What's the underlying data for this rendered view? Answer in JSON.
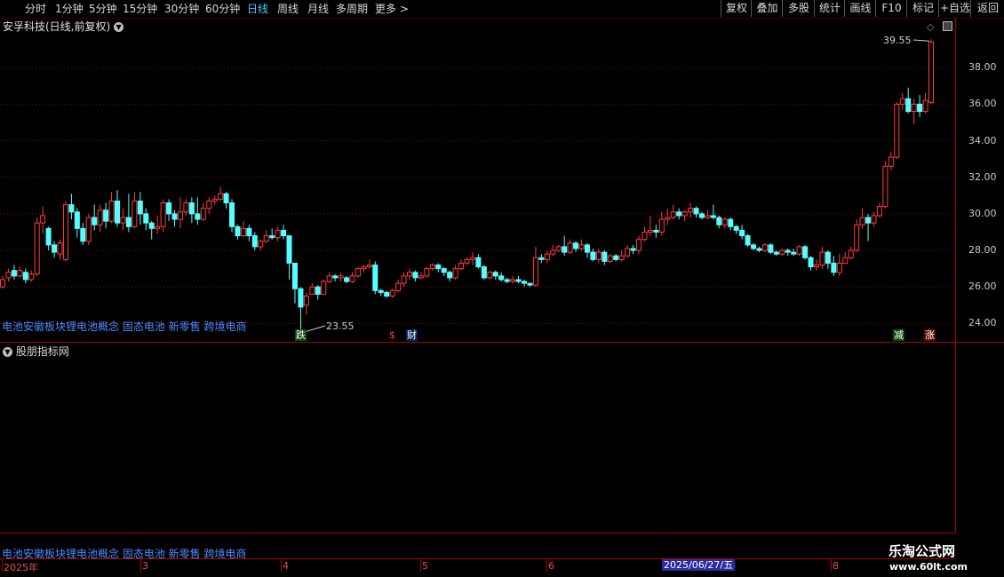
{
  "toolbar": {
    "periods": [
      "分时",
      "1分钟",
      "5分钟",
      "15分钟",
      "30分钟",
      "60分钟",
      "日线",
      "周线",
      "月线",
      "多周期",
      "更多 >"
    ],
    "active_period": "日线",
    "right_buttons": [
      "复权",
      "叠加",
      "多股",
      "统计",
      "画线",
      "F10",
      "标记",
      "+自选",
      "返回"
    ]
  },
  "chart_title": "安孚科技(日线,前复权)",
  "concepts": "电池安徽板块锂电池概念 固态电池 新零售 跨境电商",
  "indicator_title": "股朋指标网",
  "price_labels": [
    "38.00",
    "36.00",
    "34.00",
    "32.00",
    "30.00",
    "28.00",
    "26.00",
    "24.00"
  ],
  "high_marker": "39.55",
  "low_marker": "23.55",
  "tags": {
    "die": "跌",
    "s": "$",
    "cai": "财",
    "jian": "减",
    "zhang": "涨"
  },
  "dates": [
    "2025年",
    "3",
    "4",
    "5",
    "6",
    "8"
  ],
  "date_highlight": "2025/06/27/五",
  "watermark": {
    "title": "乐淘公式网",
    "url": "www.60lt.com"
  },
  "colors": {
    "up": "#ff3b3b",
    "down": "#54ffff",
    "grid": "#8a0000",
    "concept": "#4a8cff"
  },
  "chart_data": {
    "type": "candlestick",
    "ylim": [
      23,
      40
    ],
    "candles": [
      [
        26.0,
        26.4,
        25.9,
        26.6
      ],
      [
        26.5,
        26.8,
        26.3,
        27.0
      ],
      [
        26.9,
        26.6,
        26.4,
        27.2
      ],
      [
        26.6,
        26.9,
        26.5,
        27.1
      ],
      [
        26.8,
        26.4,
        26.2,
        27.0
      ],
      [
        26.4,
        26.7,
        26.3,
        26.9
      ],
      [
        26.7,
        29.5,
        26.6,
        29.8
      ],
      [
        29.5,
        29.9,
        28.9,
        30.4
      ],
      [
        29.2,
        28.3,
        28.0,
        29.3
      ],
      [
        28.3,
        27.9,
        27.6,
        28.5
      ],
      [
        27.8,
        28.4,
        27.5,
        28.6
      ],
      [
        27.5,
        30.5,
        27.4,
        30.7
      ],
      [
        30.5,
        30.1,
        29.7,
        31.1
      ],
      [
        30.1,
        29.2,
        28.7,
        30.3
      ],
      [
        29.2,
        28.5,
        28.3,
        29.5
      ],
      [
        28.5,
        29.8,
        28.3,
        30.0
      ],
      [
        29.8,
        29.4,
        29.1,
        30.5
      ],
      [
        29.4,
        30.2,
        29.0,
        30.5
      ],
      [
        30.2,
        29.6,
        29.2,
        30.6
      ],
      [
        29.6,
        30.7,
        29.5,
        31.2
      ],
      [
        30.7,
        29.5,
        29.3,
        31.3
      ],
      [
        29.5,
        29.8,
        29.1,
        30.3
      ],
      [
        29.8,
        29.3,
        29.0,
        31.1
      ],
      [
        29.3,
        30.7,
        29.2,
        31.2
      ],
      [
        30.7,
        30.0,
        29.4,
        31.2
      ],
      [
        30.0,
        29.5,
        29.1,
        30.3
      ],
      [
        29.5,
        29.2,
        28.6,
        29.6
      ],
      [
        29.2,
        29.3,
        28.9,
        29.9
      ],
      [
        29.3,
        30.6,
        29.0,
        30.8
      ],
      [
        30.6,
        30.0,
        29.6,
        30.8
      ],
      [
        30.0,
        29.7,
        29.3,
        30.2
      ],
      [
        29.7,
        30.1,
        29.2,
        30.9
      ],
      [
        30.1,
        30.6,
        29.9,
        30.8
      ],
      [
        30.6,
        30.0,
        29.5,
        30.9
      ],
      [
        30.0,
        29.7,
        29.4,
        30.9
      ],
      [
        29.7,
        30.3,
        29.6,
        30.6
      ],
      [
        30.3,
        30.7,
        30.0,
        30.9
      ],
      [
        30.7,
        30.8,
        30.5,
        31.0
      ],
      [
        30.8,
        31.1,
        30.7,
        31.5
      ],
      [
        31.1,
        30.6,
        30.3,
        31.2
      ],
      [
        30.6,
        29.3,
        29.0,
        30.8
      ],
      [
        29.3,
        28.8,
        28.6,
        29.4
      ],
      [
        28.8,
        29.2,
        28.7,
        29.6
      ],
      [
        29.2,
        28.8,
        28.5,
        29.4
      ],
      [
        28.8,
        28.2,
        28.0,
        29.0
      ],
      [
        28.2,
        28.5,
        28.0,
        28.6
      ],
      [
        28.5,
        28.8,
        28.4,
        29.1
      ],
      [
        28.8,
        28.7,
        28.6,
        29.2
      ],
      [
        28.7,
        29.1,
        28.5,
        29.3
      ],
      [
        29.1,
        28.8,
        28.6,
        29.4
      ],
      [
        28.8,
        27.3,
        26.4,
        28.3
      ],
      [
        27.3,
        25.9,
        25.1,
        27.3
      ],
      [
        25.9,
        24.9,
        23.5,
        26.0
      ],
      [
        25.0,
        25.5,
        24.5,
        25.7
      ],
      [
        25.6,
        26.0,
        25.6,
        26.2
      ],
      [
        26.0,
        25.6,
        25.3,
        26.1
      ],
      [
        25.6,
        26.3,
        25.6,
        26.4
      ],
      [
        26.3,
        26.6,
        26.2,
        26.8
      ],
      [
        26.6,
        26.5,
        26.3,
        26.7
      ],
      [
        26.5,
        26.6,
        26.3,
        26.8
      ],
      [
        26.5,
        26.3,
        26.2,
        26.6
      ],
      [
        26.3,
        26.6,
        26.2,
        26.8
      ],
      [
        26.6,
        27.0,
        26.5,
        27.1
      ],
      [
        27.0,
        27.1,
        26.8,
        27.2
      ],
      [
        27.1,
        27.2,
        27.0,
        27.5
      ],
      [
        27.2,
        25.8,
        25.6,
        27.4
      ],
      [
        25.8,
        25.7,
        25.5,
        25.9
      ],
      [
        25.7,
        25.5,
        25.4,
        25.8
      ],
      [
        25.5,
        25.8,
        25.4,
        25.9
      ],
      [
        25.8,
        26.2,
        25.7,
        26.4
      ],
      [
        26.2,
        26.6,
        26.0,
        26.8
      ],
      [
        26.6,
        26.8,
        26.4,
        27.0
      ],
      [
        26.8,
        26.5,
        26.3,
        26.9
      ],
      [
        26.5,
        26.6,
        26.4,
        26.8
      ],
      [
        26.6,
        27.0,
        26.5,
        27.1
      ],
      [
        27.0,
        27.2,
        26.9,
        27.3
      ],
      [
        27.2,
        27.0,
        26.8,
        27.3
      ],
      [
        27.0,
        26.8,
        26.6,
        27.1
      ],
      [
        26.8,
        26.5,
        26.3,
        26.9
      ],
      [
        26.5,
        27.0,
        26.4,
        27.2
      ],
      [
        27.0,
        27.3,
        26.9,
        27.5
      ],
      [
        27.3,
        27.5,
        27.2,
        27.6
      ],
      [
        27.5,
        27.6,
        27.2,
        27.9
      ],
      [
        27.6,
        27.1,
        27.0,
        27.8
      ],
      [
        27.1,
        26.5,
        26.4,
        27.2
      ],
      [
        26.5,
        26.8,
        26.4,
        26.9
      ],
      [
        26.8,
        26.6,
        26.4,
        26.9
      ],
      [
        26.6,
        26.4,
        26.3,
        26.8
      ],
      [
        26.4,
        26.3,
        26.2,
        26.5
      ],
      [
        26.3,
        26.4,
        26.2,
        26.6
      ],
      [
        26.4,
        26.3,
        26.2,
        26.6
      ],
      [
        26.3,
        26.2,
        26.0,
        26.4
      ],
      [
        26.2,
        26.1,
        26.0,
        26.2
      ],
      [
        26.1,
        27.6,
        26.0,
        28.2
      ],
      [
        27.6,
        27.5,
        27.3,
        27.8
      ],
      [
        27.5,
        27.8,
        27.3,
        28.0
      ],
      [
        27.8,
        28.0,
        27.7,
        28.3
      ],
      [
        28.0,
        28.2,
        27.9,
        28.3
      ],
      [
        28.2,
        27.9,
        27.7,
        28.8
      ],
      [
        27.9,
        28.4,
        27.8,
        28.6
      ],
      [
        28.4,
        28.1,
        27.9,
        28.5
      ],
      [
        28.1,
        28.3,
        28.0,
        28.6
      ],
      [
        28.3,
        27.9,
        27.6,
        28.4
      ],
      [
        27.9,
        27.5,
        27.4,
        28.1
      ],
      [
        27.5,
        27.9,
        27.3,
        28.1
      ],
      [
        27.9,
        27.4,
        27.2,
        28.0
      ],
      [
        27.4,
        27.7,
        27.3,
        27.8
      ],
      [
        27.7,
        27.5,
        27.4,
        27.8
      ],
      [
        27.5,
        27.7,
        27.4,
        28.0
      ],
      [
        27.7,
        28.1,
        27.6,
        28.3
      ],
      [
        28.1,
        28.0,
        27.8,
        28.3
      ],
      [
        28.0,
        28.6,
        27.8,
        28.8
      ],
      [
        28.6,
        29.0,
        28.5,
        29.3
      ],
      [
        29.0,
        29.1,
        28.8,
        29.9
      ],
      [
        29.1,
        29.0,
        28.7,
        29.4
      ],
      [
        29.0,
        29.7,
        28.8,
        30.1
      ],
      [
        29.7,
        29.8,
        29.4,
        30.3
      ],
      [
        29.8,
        30.1,
        29.7,
        30.5
      ],
      [
        30.1,
        29.9,
        29.7,
        30.3
      ],
      [
        29.9,
        30.1,
        29.6,
        30.2
      ],
      [
        30.1,
        30.3,
        29.8,
        30.6
      ],
      [
        30.3,
        30.0,
        29.8,
        30.4
      ],
      [
        30.0,
        29.8,
        29.7,
        30.1
      ],
      [
        29.8,
        29.9,
        29.7,
        30.2
      ],
      [
        29.9,
        29.8,
        29.7,
        30.5
      ],
      [
        29.8,
        29.4,
        29.2,
        29.9
      ],
      [
        29.4,
        29.7,
        29.2,
        29.8
      ],
      [
        29.7,
        29.3,
        29.1,
        29.8
      ],
      [
        29.3,
        29.1,
        28.9,
        29.4
      ],
      [
        29.1,
        28.8,
        28.6,
        29.4
      ],
      [
        28.8,
        28.3,
        28.2,
        28.9
      ],
      [
        28.3,
        28.1,
        28.0,
        28.4
      ],
      [
        28.1,
        28.0,
        27.9,
        28.2
      ],
      [
        28.0,
        28.3,
        27.9,
        28.4
      ],
      [
        28.3,
        27.9,
        27.8,
        28.4
      ],
      [
        27.9,
        27.8,
        27.7,
        28.0
      ],
      [
        27.8,
        28.0,
        27.7,
        28.1
      ],
      [
        28.0,
        27.9,
        27.7,
        28.1
      ],
      [
        27.9,
        27.8,
        27.7,
        28.1
      ],
      [
        27.8,
        28.2,
        27.7,
        28.3
      ],
      [
        28.2,
        27.6,
        27.5,
        28.3
      ],
      [
        27.6,
        27.1,
        26.9,
        27.7
      ],
      [
        27.1,
        27.2,
        26.9,
        27.5
      ],
      [
        27.2,
        27.9,
        27.0,
        28.2
      ],
      [
        27.9,
        27.3,
        27.0,
        28.0
      ],
      [
        27.3,
        26.8,
        26.6,
        27.7
      ],
      [
        26.8,
        27.3,
        26.6,
        27.8
      ],
      [
        27.3,
        27.6,
        27.3,
        27.9
      ],
      [
        27.6,
        28.0,
        27.5,
        28.2
      ],
      [
        28.0,
        29.4,
        27.9,
        29.7
      ],
      [
        29.4,
        29.8,
        29.2,
        30.3
      ],
      [
        29.8,
        29.5,
        28.5,
        30.0
      ],
      [
        29.5,
        29.9,
        29.3,
        30.1
      ],
      [
        29.9,
        30.4,
        29.8,
        30.6
      ],
      [
        30.4,
        32.6,
        30.3,
        32.9
      ],
      [
        32.6,
        33.1,
        32.4,
        33.4
      ],
      [
        33.1,
        36.0,
        33.0,
        36.1
      ],
      [
        36.0,
        36.3,
        35.7,
        36.6
      ],
      [
        36.3,
        35.6,
        35.5,
        36.9
      ],
      [
        35.6,
        36.0,
        34.9,
        36.3
      ],
      [
        36.0,
        35.6,
        35.3,
        36.5
      ],
      [
        35.6,
        36.2,
        35.5,
        36.6
      ],
      [
        36.1,
        39.4,
        36.0,
        39.55
      ]
    ]
  }
}
